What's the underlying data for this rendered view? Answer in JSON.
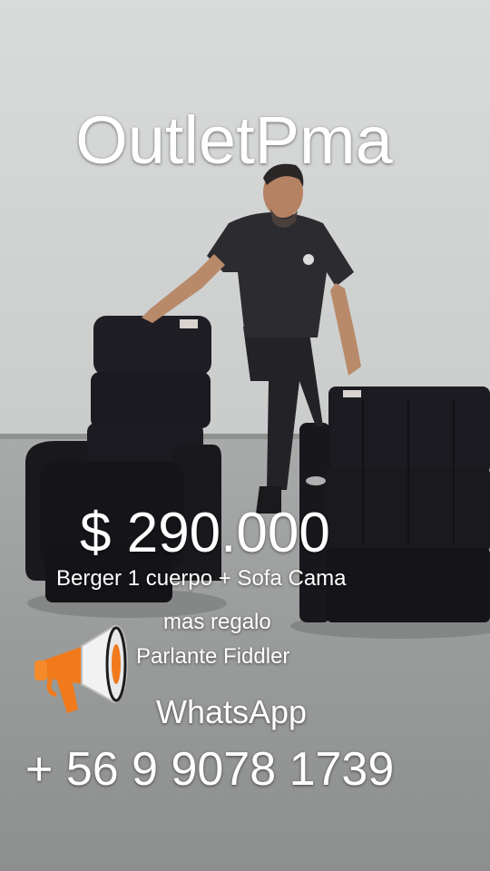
{
  "overlay": {
    "brand": "OutletPma",
    "price": "$ 290.000",
    "product_line": "Berger 1 cuerpo + Sofa Cama",
    "gift_intro": "mas regalo",
    "gift_item": "Parlante Fiddler",
    "contact_label": "WhatsApp",
    "phone": "+ 56 9 9078 1739"
  },
  "icons": {
    "megaphone": "megaphone-icon"
  },
  "colors": {
    "text": "#ffffff",
    "wall": "#d6d8d7",
    "floor": "#9c9e9d",
    "furniture": "#1b1a1f",
    "megaphone_orange": "#f07a1c"
  }
}
